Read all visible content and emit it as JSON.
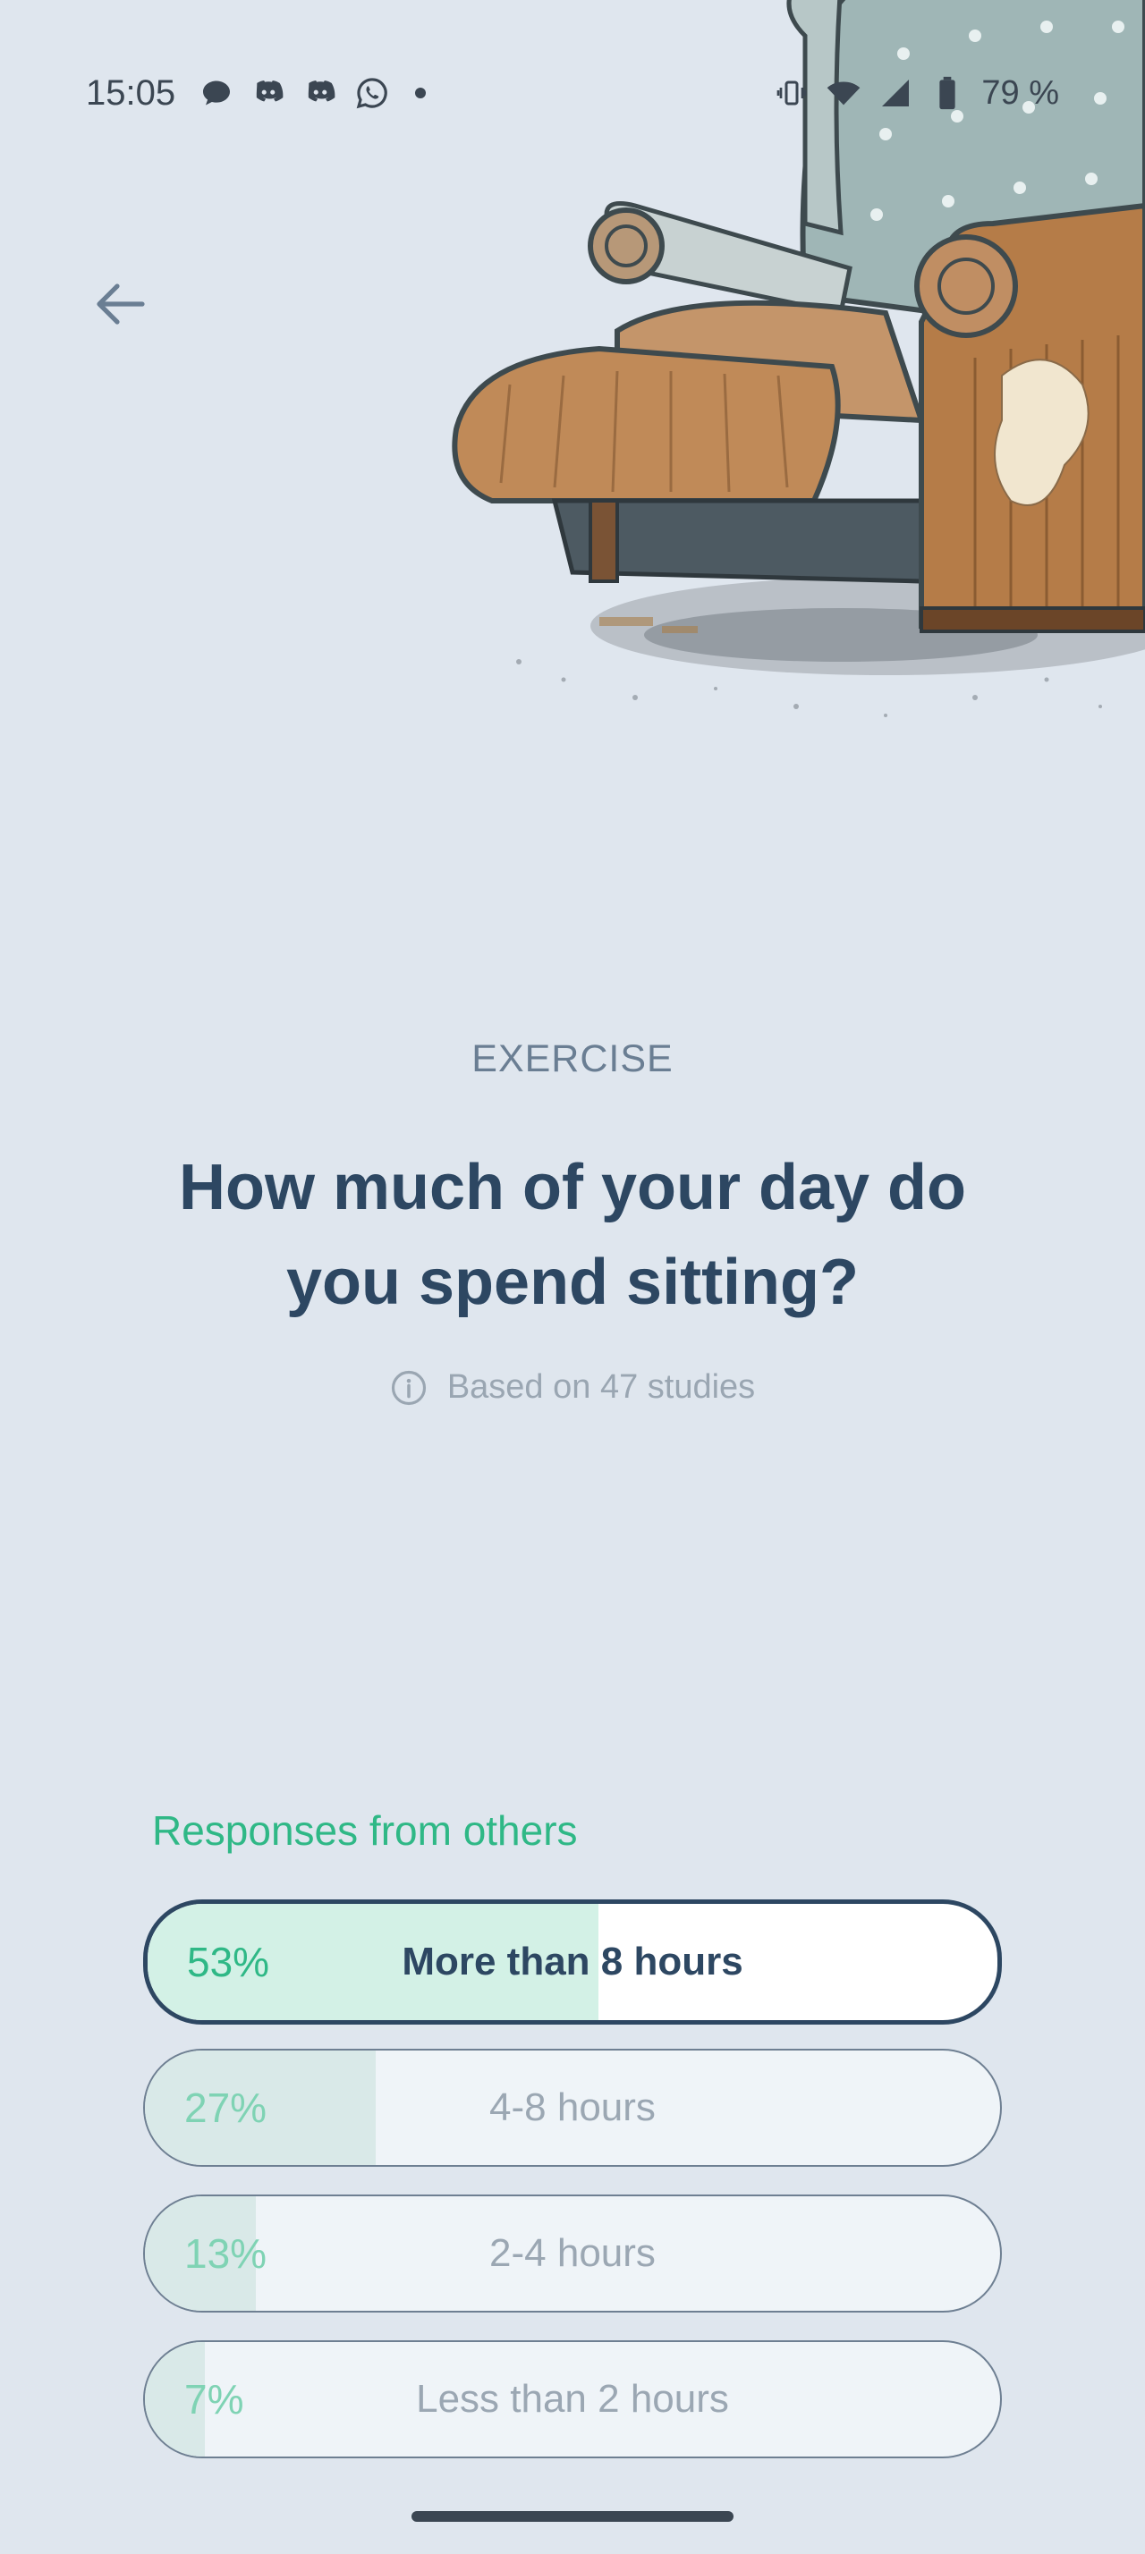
{
  "status_bar": {
    "time": "15:05",
    "battery": "79 %",
    "notification_icons": [
      "chat-bubble-icon",
      "discord-icon",
      "discord-icon",
      "whatsapp-icon"
    ],
    "system_icons": [
      "vibrate-icon",
      "wifi-icon",
      "signal-icon",
      "battery-icon"
    ]
  },
  "header": {
    "back_icon": "arrow-left-icon",
    "illustration": "armchair-recliner-illustration"
  },
  "question": {
    "category": "EXERCISE",
    "title": "How much of your day do you spend sitting?",
    "studies_note": "Based on 47 studies",
    "info_icon": "info-circle-icon"
  },
  "responses": {
    "heading": "Responses from others",
    "options": [
      {
        "percent_label": "53%",
        "percent": 53,
        "label": "More than 8 hours",
        "selected": true
      },
      {
        "percent_label": "27%",
        "percent": 27,
        "label": "4-8 hours",
        "selected": false
      },
      {
        "percent_label": "13%",
        "percent": 13,
        "label": "2-4 hours",
        "selected": false
      },
      {
        "percent_label": "7%",
        "percent": 7,
        "label": "Less than 2 hours",
        "selected": false
      }
    ]
  },
  "colors": {
    "background": "#dfe6ee",
    "title": "#2d4762",
    "accent_green": "#2fb886",
    "selected_border": "#2d4762"
  }
}
